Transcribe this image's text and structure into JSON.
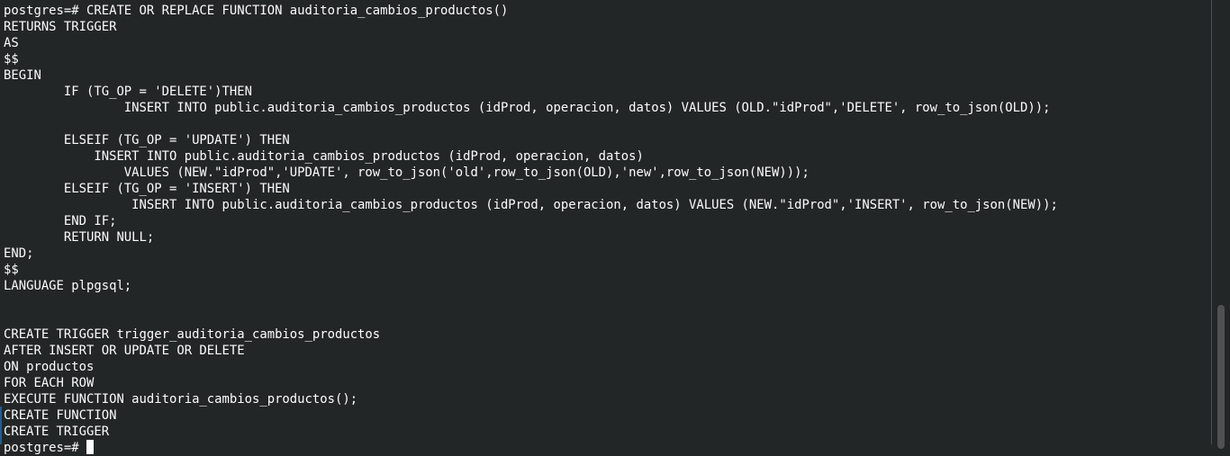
{
  "terminal": {
    "lines": [
      "postgres=# CREATE OR REPLACE FUNCTION auditoria_cambios_productos()",
      "RETURNS TRIGGER",
      "AS",
      "$$",
      "BEGIN",
      "        IF (TG_OP = 'DELETE')THEN",
      "                INSERT INTO public.auditoria_cambios_productos (idProd, operacion, datos) VALUES (OLD.\"idProd\",'DELETE', row_to_json(OLD));",
      "",
      "        ELSEIF (TG_OP = 'UPDATE') THEN",
      "            INSERT INTO public.auditoria_cambios_productos (idProd, operacion, datos)",
      "                VALUES (NEW.\"idProd\",'UPDATE', row_to_json('old',row_to_json(OLD),'new',row_to_json(NEW)));",
      "        ELSEIF (TG_OP = 'INSERT') THEN",
      "                 INSERT INTO public.auditoria_cambios_productos (idProd, operacion, datos) VALUES (NEW.\"idProd\",'INSERT', row_to_json(NEW));",
      "        END IF;",
      "        RETURN NULL;",
      "END;",
      "$$",
      "LANGUAGE plpgsql;",
      "",
      "",
      "CREATE TRIGGER trigger_auditoria_cambios_productos",
      "AFTER INSERT OR UPDATE OR DELETE",
      "ON productos",
      "FOR EACH ROW",
      "EXECUTE FUNCTION auditoria_cambios_productos();",
      "CREATE FUNCTION",
      "CREATE TRIGGER"
    ],
    "prompt": "postgres=# "
  },
  "colors": {
    "background": "#232627",
    "foreground": "#fcfcfc"
  }
}
